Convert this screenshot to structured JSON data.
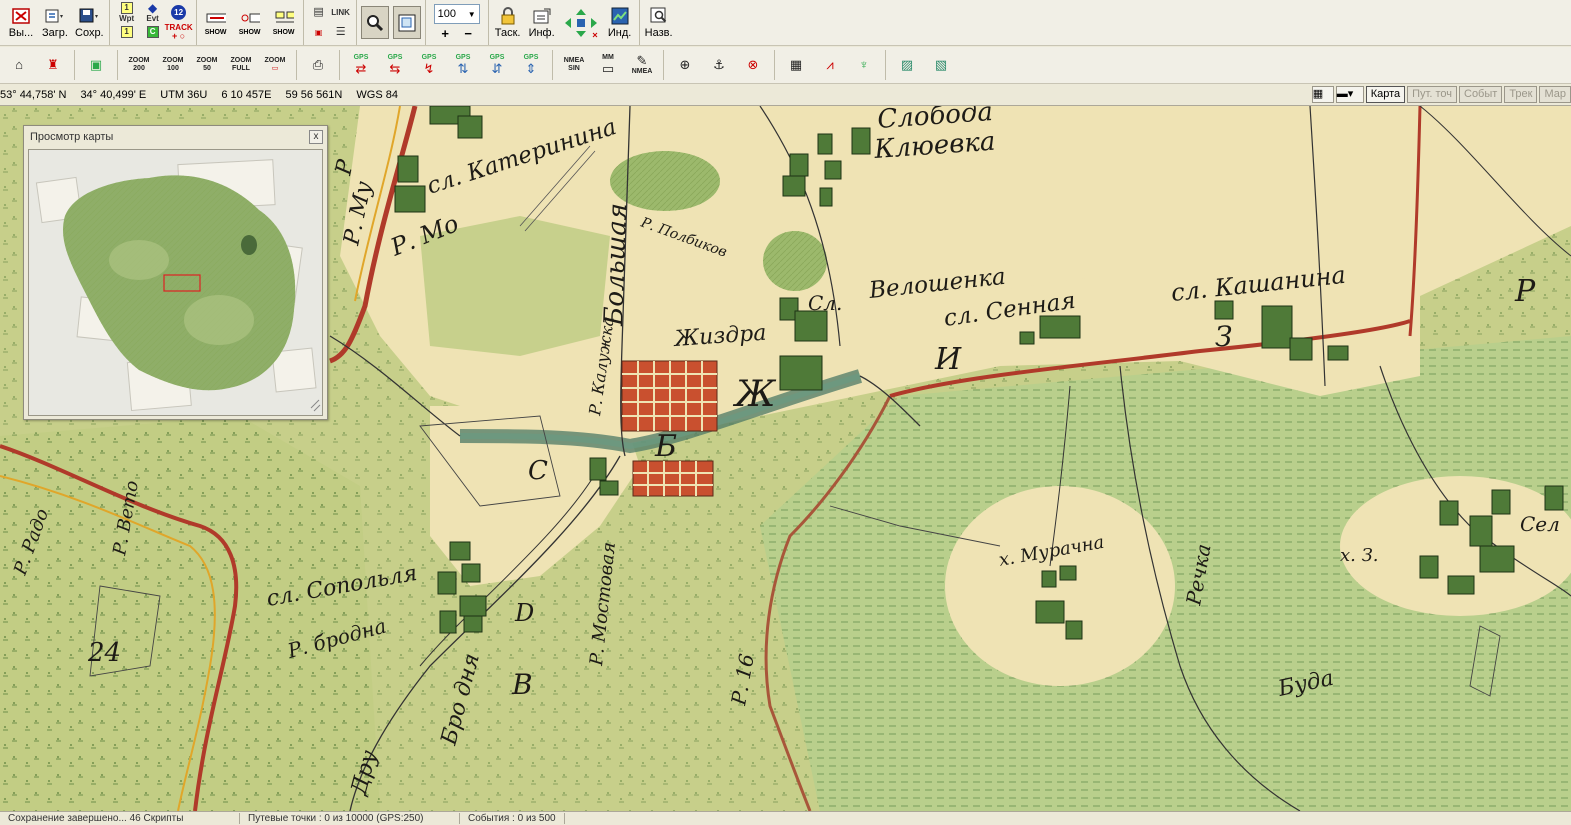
{
  "toolbar1": {
    "exit_label": "Вы...",
    "load_label": "Загр.",
    "save_label": "Сохр.",
    "wpt_label": "Wpt",
    "evt_label": "Evt",
    "badge_12": "12",
    "track_label": "TRACK",
    "c_label": "C",
    "show1_label": "SHOW",
    "show2_label": "SHOW",
    "show3_label": "SHOW",
    "link_label": "LINK",
    "zoom_value": "100",
    "tasks_label": "Таск.",
    "info_label": "Инф.",
    "ind_label": "Инд.",
    "names_label": "Назв."
  },
  "toolbar2": {
    "zoom200": [
      "ZOOM",
      "200"
    ],
    "zoom100": [
      "ZOOM",
      "100"
    ],
    "zoom50": [
      "ZOOM",
      "50"
    ],
    "zoomfull": [
      "ZOOM",
      "FULL"
    ],
    "zoom": "ZOOM",
    "gps": "GPS",
    "nmea_sin": [
      "NMEA",
      "SIN"
    ],
    "mm": "MM",
    "nmea": "NMEA"
  },
  "coords": {
    "lat": "53° 44,758' N",
    "lon": "34° 40,499' E",
    "utm": "UTM  36U",
    "easting": "6 10 457E",
    "northing": "59 56 561N",
    "datum": "WGS 84"
  },
  "view_tabs": [
    "Карта",
    "Пут. точ",
    "Событ",
    "Трек",
    "Мар"
  ],
  "overview": {
    "title": "Просмотр карты",
    "close": "x"
  },
  "map_labels": {
    "sloboda": "Слобода",
    "kluevka": "Клюевка",
    "r_mu": "Р. Му",
    "r_mo": "Р. Мо",
    "ekaterinina": "сл. Катеринина",
    "bolshaya": "Большая",
    "r_pol": "Р. Полбиков",
    "veloshenka": "Велошенка",
    "sl": "Сл.",
    "sennaya": "сл. Сенная",
    "kashanina": "сл. Кашанина",
    "zhizdra": "Жиздра",
    "zh": "Ж",
    "i": "И",
    "z": "З",
    "r_kaluzhka": "Р. Калужка",
    "r": "Р",
    "b_ya": "Б",
    "sl_sopolya": "сл. Сопольля",
    "brodna": "Р. бродна",
    "s": "С",
    "d": "D",
    "v": "В",
    "r_mostovaya": "Р. Мостовая",
    "h_muracha": "х. Мурачна",
    "rechka": "Речка",
    "buda": "Буда",
    "h_z": "х. З.",
    "sel": "Сел",
    "num_24": "24",
    "r_veto": "Р. Вето",
    "r_rado": "Р. Радо",
    "bro_dnya": "Бро дня",
    "p_r": "Р",
    "drug": "Дру",
    "r16": "Р. 16"
  },
  "status": {
    "loading": "Сохранение завершено... 46 Скрипты",
    "waypoints": "Путевые точки : 0 из 10000   (GPS:250)",
    "events": "События : 0 из 500"
  },
  "colors": {
    "map_green": "#c7cf8a",
    "field_cream": "#efe3b4",
    "forest": "#7fae5c",
    "boundary_red": "#b03a2a",
    "river_teal": "#4d7a66"
  }
}
